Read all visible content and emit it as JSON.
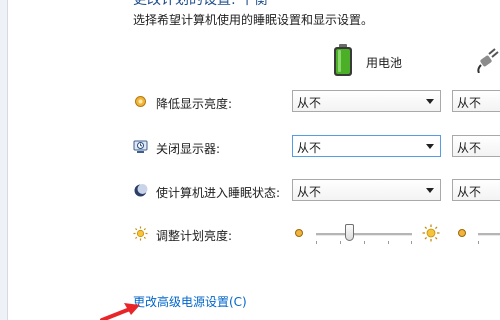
{
  "header": {
    "title_partial": "更改计划的设置: 平衡",
    "subtitle": "选择希望计算机使用的睡眠设置和显示设置。"
  },
  "columns": {
    "battery_label": "用电池"
  },
  "settings": {
    "dim_display": {
      "label": "降低显示亮度:",
      "battery_value": "从不",
      "plugged_value": "从不"
    },
    "turn_off_display": {
      "label": "关闭显示器:",
      "battery_value": "从不",
      "plugged_value": "从不"
    },
    "sleep": {
      "label": "使计算机进入睡眠状态:",
      "battery_value": "从不",
      "plugged_value": "从不"
    },
    "brightness": {
      "label": "调整计划亮度:",
      "battery_level": 0.35
    }
  },
  "links": {
    "advanced": "更改高级电源设置(C)"
  },
  "colors": {
    "link": "#0066cc",
    "heading": "#1e4e8c",
    "focus_border": "#569de5",
    "battery_green": "#4caf28",
    "arrow_red": "#e8262a"
  },
  "icons": [
    "battery-icon",
    "plug-icon",
    "dim-display-icon",
    "display-off-icon",
    "sleep-moon-icon",
    "brightness-sun-icon",
    "sun-small-icon",
    "sun-large-icon"
  ]
}
